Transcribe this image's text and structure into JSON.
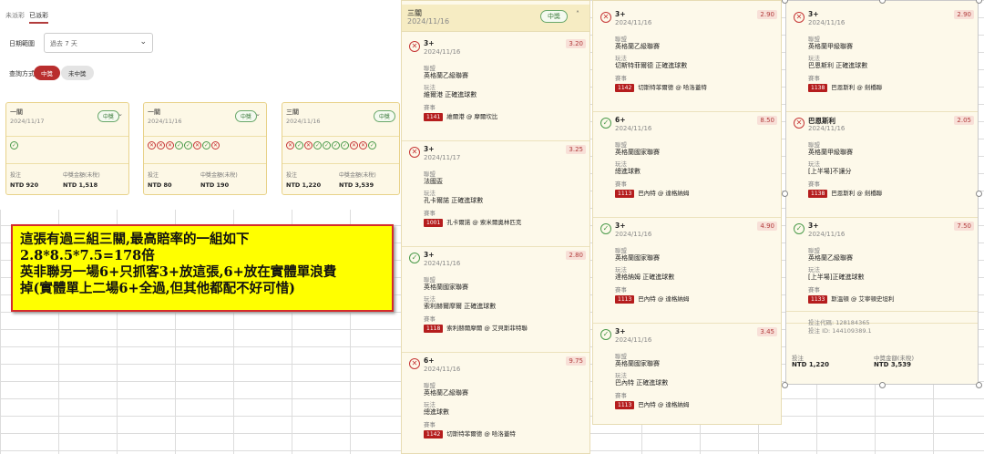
{
  "left": {
    "tabs": [
      "未派彩",
      "已派彩"
    ],
    "date_label": "日期範圍",
    "date_value": "過去 7 天",
    "method_label": "查詢方式",
    "pill_on": "中獎",
    "pill_off": "未中獎"
  },
  "summary_cards": [
    {
      "title": "一關",
      "date": "2024/11/17",
      "badge": "中獎",
      "icons": [
        "win"
      ],
      "stake_label": "投注",
      "stake": "NTD 920",
      "win_label": "中獎金額(未稅)",
      "win": "NTD 1,518"
    },
    {
      "title": "一關",
      "date": "2024/11/16",
      "badge": "中獎",
      "icons": [
        "lose",
        "lose",
        "lose",
        "win",
        "win",
        "lose",
        "win",
        "lose"
      ],
      "stake_label": "投注",
      "stake": "NTD 80",
      "win_label": "中獎金額(未稅)",
      "win": "NTD 190"
    },
    {
      "title": "三關",
      "date": "2024/11/16",
      "badge": "中獎",
      "icons": [
        "lose",
        "win",
        "lose",
        "win",
        "win",
        "win",
        "win",
        "lose",
        "lose",
        "win"
      ],
      "stake_label": "投注",
      "stake": "NTD 1,220",
      "win_label": "中獎金額(未稅)",
      "win": "NTD 3,539"
    }
  ],
  "note": {
    "lines": [
      "這張有過三組三關,最高賠率的一組如下",
      "2.8*8.5*7.5=178倍",
      "英非聯另一場6+只抓客3+放這張,6+放在實體單浪費",
      "掉(實體單上二場6+全過,但其他都配不好可惜)"
    ]
  },
  "col1": {
    "title": "三關",
    "date": "2024/11/16",
    "badge": "中獎",
    "legs": [
      {
        "status": "lose",
        "pick": "3+",
        "date": "2024/11/16",
        "odds": "3.20",
        "league_label": "聯盟",
        "league": "英格蘭乙級聯賽",
        "play_label": "玩法",
        "play": "維爾港 正確進球數",
        "match_label": "賽事",
        "match_id": "1141",
        "match": "維爾港 @ 摩爾坎比"
      },
      {
        "status": "lose",
        "pick": "3+",
        "date": "2024/11/17",
        "odds": "3.25",
        "league_label": "聯盟",
        "league": "法國盃",
        "play_label": "玩法",
        "play": "孔卡爾諾 正確進球數",
        "match_label": "賽事",
        "match_id": "1001",
        "match": "孔卡爾諾 @ 索米爾奧林匹克"
      },
      {
        "status": "win",
        "pick": "3+",
        "date": "2024/11/16",
        "odds": "2.80",
        "league_label": "聯盟",
        "league": "英格蘭國家聯賽",
        "play_label": "玩法",
        "play": "索利赫爾摩爾 正確進球數",
        "match_label": "賽事",
        "match_id": "1118",
        "match": "索利赫爾摩爾 @ 艾貝斯菲特聯"
      },
      {
        "status": "lose",
        "pick": "6+",
        "date": "2024/11/16",
        "odds": "9.75",
        "league_label": "聯盟",
        "league": "英格蘭乙級聯賽",
        "play_label": "玩法",
        "play": "總進球數",
        "match_label": "賽事",
        "match_id": "1142",
        "match": "切斯特菲爾德 @ 哈洛蓋特"
      }
    ]
  },
  "col2": {
    "legs": [
      {
        "status": "lose",
        "pick": "3+",
        "date": "2024/11/16",
        "odds": "2.90",
        "league_label": "聯盟",
        "league": "英格蘭乙級聯賽",
        "play_label": "玩法",
        "play": "切斯特菲爾德 正確進球數",
        "match_label": "賽事",
        "match_id": "1142",
        "match": "切斯特菲爾德 @ 哈洛蓋特"
      },
      {
        "status": "win",
        "pick": "6+",
        "date": "2024/11/16",
        "odds": "8.50",
        "league_label": "聯盟",
        "league": "英格蘭國家聯賽",
        "play_label": "玩法",
        "play": "總進球數",
        "match_label": "賽事",
        "match_id": "1113",
        "match": "巴內特 @ 達格納姆"
      },
      {
        "status": "win",
        "pick": "3+",
        "date": "2024/11/16",
        "odds": "4.90",
        "league_label": "聯盟",
        "league": "英格蘭國家聯賽",
        "play_label": "玩法",
        "play": "達格納姆 正確進球數",
        "match_label": "賽事",
        "match_id": "1113",
        "match": "巴內特 @ 達格納姆"
      },
      {
        "status": "win",
        "pick": "3+",
        "date": "2024/11/16",
        "odds": "3.45",
        "league_label": "聯盟",
        "league": "英格蘭國家聯賽",
        "play_label": "玩法",
        "play": "巴內特 正確進球數",
        "match_label": "賽事",
        "match_id": "1113",
        "match": "巴內特 @ 達格納姆"
      }
    ]
  },
  "col3": {
    "legs": [
      {
        "status": "lose",
        "pick": "3+",
        "date": "2024/11/16",
        "odds": "2.90",
        "league_label": "聯盟",
        "league": "英格蘭甲級聯賽",
        "play_label": "玩法",
        "play": "巴恩斯利 正確進球數",
        "match_label": "賽事",
        "match_id": "1138",
        "match": "巴恩斯利 @ 劍橋聯"
      },
      {
        "status": "lose",
        "pick": "巴恩斯利",
        "date": "2024/11/16",
        "odds": "2.05",
        "league_label": "聯盟",
        "league": "英格蘭甲級聯賽",
        "play_label": "玩法",
        "play": "[上半場]不讓分",
        "match_label": "賽事",
        "match_id": "1138",
        "match": "巴恩斯利 @ 劍橋聯"
      },
      {
        "status": "win",
        "pick": "3+",
        "date": "2024/11/16",
        "odds": "7.50",
        "league_label": "聯盟",
        "league": "英格蘭乙級聯賽",
        "play_label": "玩法",
        "play": "[上半場]正確進球數",
        "match_label": "賽事",
        "match_id": "1133",
        "match": "斯溫頓 @ 艾寧頓史坦利"
      }
    ],
    "code_label": "投注代碼: 128184365",
    "id_label": "投注 ID: 144109389.1",
    "stake_label": "投注",
    "stake": "NTD 1,220",
    "win_label": "中獎金額(未稅)",
    "win": "NTD 3,539"
  }
}
